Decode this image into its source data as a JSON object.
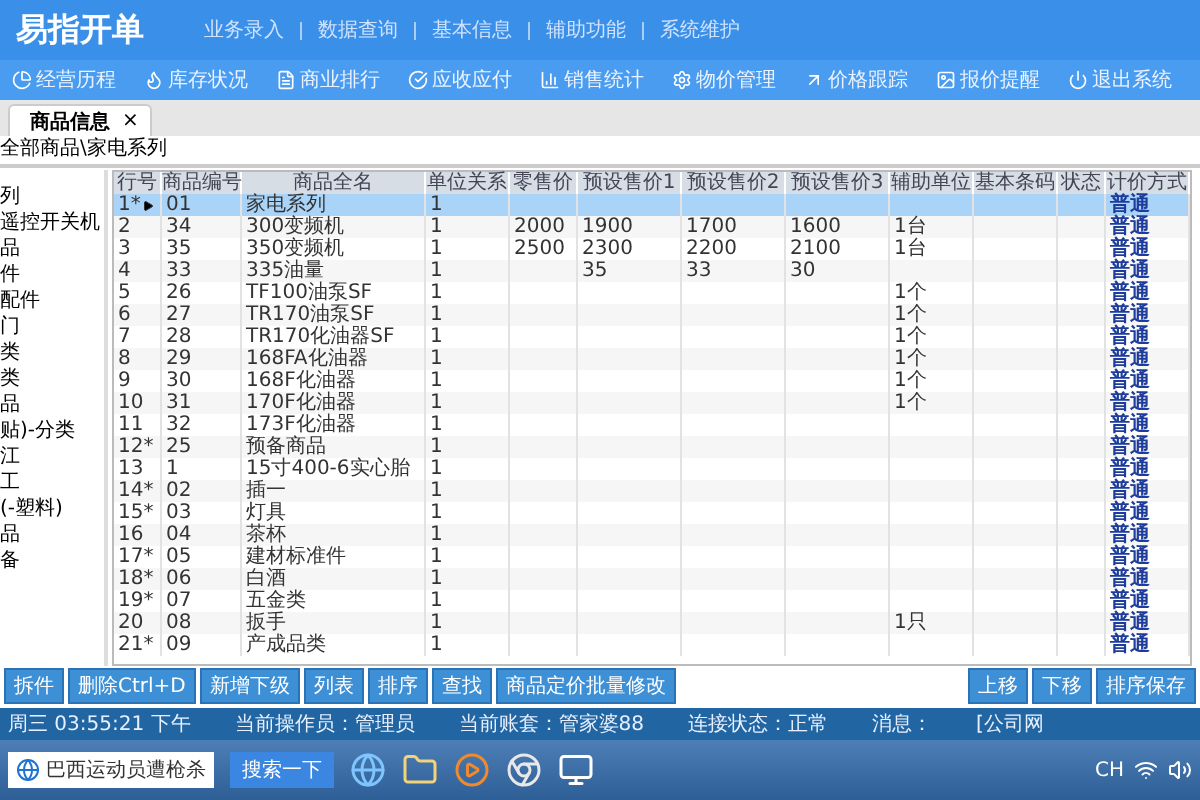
{
  "app": {
    "title": "易指开单",
    "menu": [
      "业务录入",
      "数据查询",
      "基本信息",
      "辅助功能",
      "系统维护"
    ]
  },
  "toolbar": [
    "经营历程",
    "库存状况",
    "商业排行",
    "应收应付",
    "销售统计",
    "物价管理",
    "价格跟踪",
    "报价提醒",
    "退出系统"
  ],
  "tabs": [
    {
      "label": "商品信息",
      "selected": true,
      "close": "×"
    }
  ],
  "breadcrumb": "全部商品\\家电系列",
  "tree": [
    "列",
    "遥控开关机",
    "品",
    "件",
    "配件",
    "门",
    "类",
    "类",
    "品",
    "贴)-分类",
    "江",
    "工",
    "(-塑料)",
    "品",
    "备"
  ],
  "table": {
    "columns": [
      "行号",
      "商品编号",
      "商品全名",
      "单位关系",
      "零售价",
      "预设售价1",
      "预设售价2",
      "预设售价3",
      "辅助单位",
      "基本条码",
      "状态",
      "计价方式"
    ],
    "rows": [
      {
        "selected": true,
        "cells": [
          "1*",
          "01",
          "家电系列",
          "1",
          "",
          "",
          "",
          "",
          "",
          "",
          "",
          "普通"
        ]
      },
      {
        "selected": false,
        "cells": [
          "2",
          "34",
          "300变频机",
          "1",
          "2000",
          "1900",
          "1700",
          "1600",
          "1台",
          "",
          "",
          "普通"
        ]
      },
      {
        "selected": false,
        "cells": [
          "3",
          "35",
          "350变频机",
          "1",
          "2500",
          "2300",
          "2200",
          "2100",
          "1台",
          "",
          "",
          "普通"
        ]
      },
      {
        "selected": false,
        "cells": [
          "4",
          "33",
          "335油量",
          "1",
          "",
          "35",
          "33",
          "30",
          "",
          "",
          "",
          "普通"
        ]
      },
      {
        "selected": false,
        "cells": [
          "5",
          "26",
          "TF100油泵SF",
          "1",
          "",
          "",
          "",
          "",
          "1个",
          "",
          "",
          "普通"
        ]
      },
      {
        "selected": false,
        "cells": [
          "6",
          "27",
          "TR170油泵SF",
          "1",
          "",
          "",
          "",
          "",
          "1个",
          "",
          "",
          "普通"
        ]
      },
      {
        "selected": false,
        "cells": [
          "7",
          "28",
          "TR170化油器SF",
          "1",
          "",
          "",
          "",
          "",
          "1个",
          "",
          "",
          "普通"
        ]
      },
      {
        "selected": false,
        "cells": [
          "8",
          "29",
          "168FA化油器",
          "1",
          "",
          "",
          "",
          "",
          "1个",
          "",
          "",
          "普通"
        ]
      },
      {
        "selected": false,
        "cells": [
          "9",
          "30",
          "168F化油器",
          "1",
          "",
          "",
          "",
          "",
          "1个",
          "",
          "",
          "普通"
        ]
      },
      {
        "selected": false,
        "cells": [
          "10",
          "31",
          "170F化油器",
          "1",
          "",
          "",
          "",
          "",
          "1个",
          "",
          "",
          "普通"
        ]
      },
      {
        "selected": false,
        "cells": [
          "11",
          "32",
          "173F化油器",
          "1",
          "",
          "",
          "",
          "",
          "",
          "",
          "",
          "普通"
        ]
      },
      {
        "selected": false,
        "cells": [
          "12*",
          "25",
          "预备商品",
          "1",
          "",
          "",
          "",
          "",
          "",
          "",
          "",
          "普通"
        ]
      },
      {
        "selected": false,
        "cells": [
          "13",
          "1",
          "15寸400-6实心胎",
          "1",
          "",
          "",
          "",
          "",
          "",
          "",
          "",
          "普通"
        ]
      },
      {
        "selected": false,
        "cells": [
          "14*",
          "02",
          "插一",
          "1",
          "",
          "",
          "",
          "",
          "",
          "",
          "",
          "普通"
        ]
      },
      {
        "selected": false,
        "cells": [
          "15*",
          "03",
          "灯具",
          "1",
          "",
          "",
          "",
          "",
          "",
          "",
          "",
          "普通"
        ]
      },
      {
        "selected": false,
        "cells": [
          "16",
          "04",
          "茶杯",
          "1",
          "",
          "",
          "",
          "",
          "",
          "",
          "",
          "普通"
        ]
      },
      {
        "selected": false,
        "cells": [
          "17*",
          "05",
          "建材标准件",
          "1",
          "",
          "",
          "",
          "",
          "",
          "",
          "",
          "普通"
        ]
      },
      {
        "selected": false,
        "cells": [
          "18*",
          "06",
          "白酒",
          "1",
          "",
          "",
          "",
          "",
          "",
          "",
          "",
          "普通"
        ]
      },
      {
        "selected": false,
        "cells": [
          "19*",
          "07",
          "五金类",
          "1",
          "",
          "",
          "",
          "",
          "",
          "",
          "",
          "普通"
        ]
      },
      {
        "selected": false,
        "cells": [
          "20",
          "08",
          "扳手",
          "1",
          "",
          "",
          "",
          "",
          "1只",
          "",
          "",
          "普通"
        ]
      },
      {
        "selected": false,
        "cells": [
          "21*",
          "09",
          "产成品类",
          "1",
          "",
          "",
          "",
          "",
          "",
          "",
          "",
          "普通"
        ]
      }
    ]
  },
  "actions_left": [
    "拆件",
    "删除Ctrl+D",
    "新增下级",
    "列表",
    "排序",
    "查找",
    "商品定价批量修改"
  ],
  "actions_right": [
    "上移",
    "下移",
    "排序保存"
  ],
  "status_bar": [
    "周三 03:55:21 下午",
    "当前操作员：管理员",
    "当前账套：管家婆88",
    "连接状态：正常",
    "消息：",
    "[公司网"
  ],
  "taskbar": {
    "search_text": "巴西运动员遭枪杀",
    "search_button": "搜索一下",
    "language": "CH"
  }
}
